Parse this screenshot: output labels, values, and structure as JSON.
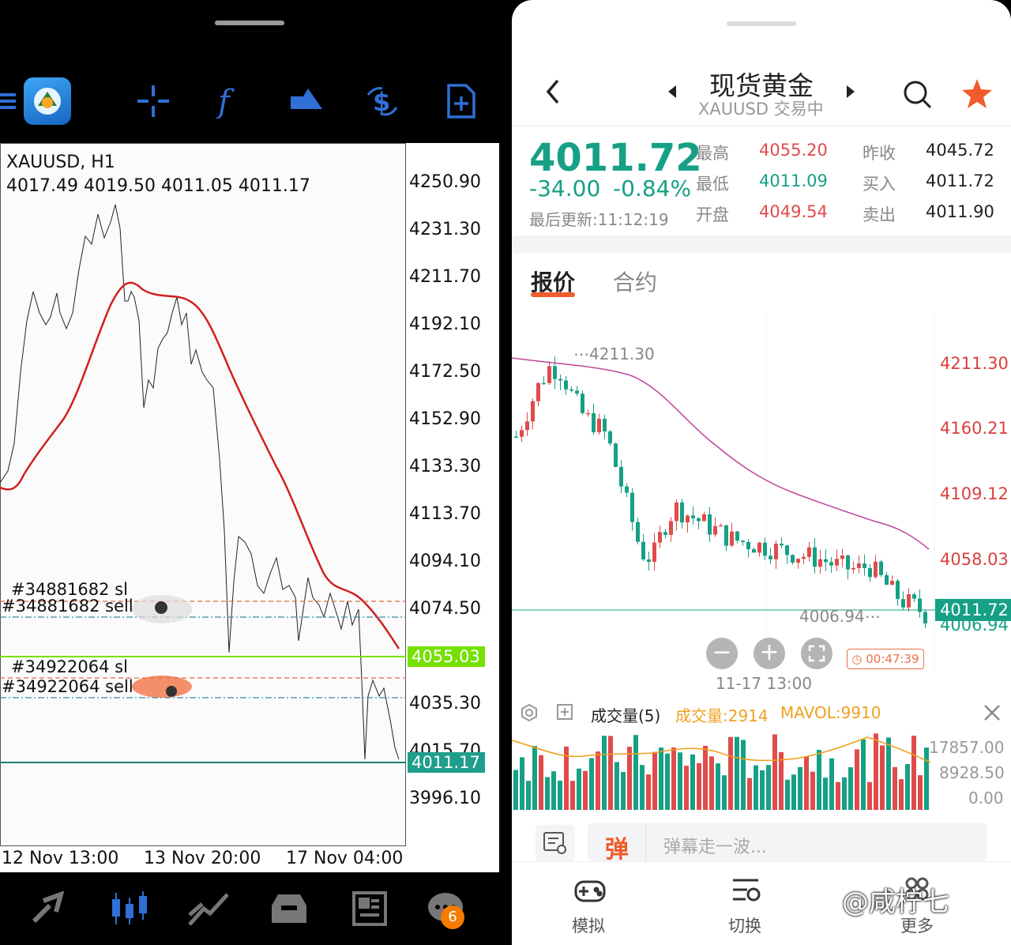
{
  "mt5": {
    "symbol_line": "XAUUSD, H1",
    "ohlc_line": "4017.49 4019.50 4011.05 4011.17",
    "price_axis": [
      "4250.90",
      "4231.30",
      "4211.70",
      "4192.10",
      "4172.50",
      "4152.90",
      "4133.30",
      "4113.70",
      "4094.10",
      "4074.50",
      "4055.03",
      "4035.30",
      "4015.70",
      "4011.17",
      "3996.10"
    ],
    "time_axis": [
      "12 Nov 13:00",
      "13 Nov 20:00",
      "17 Nov 04:00"
    ],
    "orders": [
      "#34881682 sl",
      "#34881682 sell",
      "#34922064 sl",
      "#34922064 sell"
    ],
    "current_price_box": "4011.17",
    "level_box": "4055.03",
    "level_box_color": "#76e000",
    "current_box_color": "#1f9e8c",
    "ma_color": "#d01f1f",
    "toolbar_icons": [
      "menu-icon",
      "crosshair-icon",
      "function-icon",
      "objects-icon",
      "trade-icon",
      "new-document-icon"
    ],
    "nav_icons": [
      "quotes-icon",
      "chart-icon",
      "trade-icon",
      "history-icon",
      "news-icon",
      "messages-icon"
    ],
    "messages_badge": "6"
  },
  "app": {
    "title": "现货黄金",
    "subtitle": "XAUUSD 交易中",
    "price": "4011.72",
    "change": "-34.00",
    "change_pct": "-0.84%",
    "last_update": "最后更新:11:12:19",
    "stats": {
      "high_label": "最高",
      "high_value": "4055.20",
      "low_label": "最低",
      "low_value": "4011.09",
      "open_label": "开盘",
      "open_value": "4049.54",
      "prev_close_label": "昨收",
      "prev_close_value": "4045.72",
      "bid_label": "买入",
      "bid_value": "4011.72",
      "ask_label": "卖出",
      "ask_value": "4011.90"
    },
    "tabs": [
      "报价",
      "合约"
    ],
    "price_axis": [
      "4211.30",
      "4160.21",
      "4109.12",
      "4058.03",
      "4006.94"
    ],
    "high_marker": "4211.30",
    "low_marker": "4006.94",
    "current_tag": "4011.72",
    "timer": "00:47:39",
    "time_label": "11-17 13:00",
    "volume_header": "成交量(5)",
    "volume_value": "成交量:2914",
    "mavol_value": "MAVOL:9910",
    "volume_axis": [
      "17857.00",
      "8928.50",
      "0.00"
    ],
    "danmu_placeholder": "弹幕走一波...",
    "nav": [
      "模拟",
      "切换",
      "更多"
    ],
    "watermark": "@咸柠七",
    "up_color": "#e04b4b",
    "down_color": "#16a085",
    "accent": "#f05b2b"
  }
}
